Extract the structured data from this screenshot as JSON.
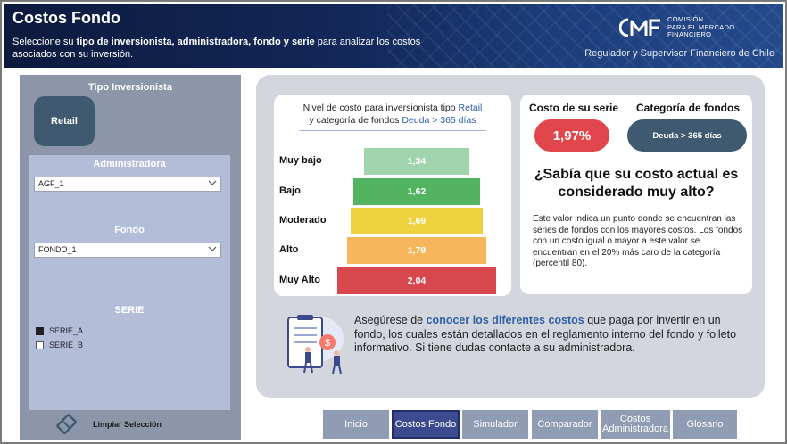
{
  "header": {
    "title": "Costos Fondo",
    "subtitle_pre": "Seleccione su ",
    "subtitle_bold": "tipo de inversionista, administradora, fondo y serie",
    "subtitle_post": " para analizar los costos asociados con su inversión.",
    "logo_text": "CMF",
    "logo_lines": [
      "COMISIÓN",
      "PARA EL MERCADO",
      "FINANCIERO"
    ],
    "tagline": "Regulador y Supervisor Financiero de Chile"
  },
  "filters": {
    "tipo_label": "Tipo Inversionista",
    "tipo_value": "Retail",
    "admin_label": "Administradora",
    "admin_value": "AGF_1",
    "fondo_label": "Fondo",
    "fondo_value": "FONDO_1",
    "serie_label": "SERIE",
    "series": [
      {
        "label": "SERIE_A",
        "checked": true
      },
      {
        "label": "SERIE_B",
        "checked": false
      }
    ],
    "clear_label": "Limpiar Selección"
  },
  "pyramid": {
    "title_line1_pre": "Nivel de costo para inversionista tipo ",
    "title_line1_hl": "Retail",
    "title_line2_pre": "y categoría de fondos ",
    "title_line2_hl": "Deuda > 365 días",
    "levels": [
      {
        "name": "Muy bajo",
        "value": "1,34",
        "color": "#9fd4ac"
      },
      {
        "name": "Bajo",
        "value": "1,62",
        "color": "#52b361"
      },
      {
        "name": "Moderado",
        "value": "1,69",
        "color": "#efd23f"
      },
      {
        "name": "Alto",
        "value": "1,79",
        "color": "#f6b65c"
      },
      {
        "name": "Muy Alto",
        "value": "2,04",
        "color": "#d9474e"
      }
    ]
  },
  "summary": {
    "cost_label": "Costo de su serie",
    "cost_value": "1,97%",
    "category_label": "Categoría de fondos",
    "category_value": "Deuda > 365 días",
    "question": "¿Sabía que su costo actual es considerado muy alto?",
    "explanation": "Este valor indica un punto donde se encuentran las series de fondos con los mayores costos. Los fondos con un costo igual o mayor a este valor se encuentran en el 20% más caro de la categoría (percentil 80)."
  },
  "info": {
    "pre": "Asegúrese de ",
    "hl": "conocer los diferentes costos",
    "post": " que paga por invertir en un fondo, los cuales están detallados en el reglamento interno del fondo y folleto informativo. Si tiene dudas contacte a su administradora."
  },
  "nav": [
    {
      "label": "Inicio",
      "active": false
    },
    {
      "label": "Costos Fondo",
      "active": true
    },
    {
      "label": "Simulador",
      "active": false
    },
    {
      "label": "Comparador",
      "active": false
    },
    {
      "label": "Costos Administradora",
      "active": false
    },
    {
      "label": "Glosario",
      "active": false
    }
  ],
  "colors": {
    "accent_blue": "#2f5fa8",
    "high_cost_red": "#e0464b",
    "dark_slate": "#3f5a70",
    "nav_active": "#3c4a8f"
  }
}
